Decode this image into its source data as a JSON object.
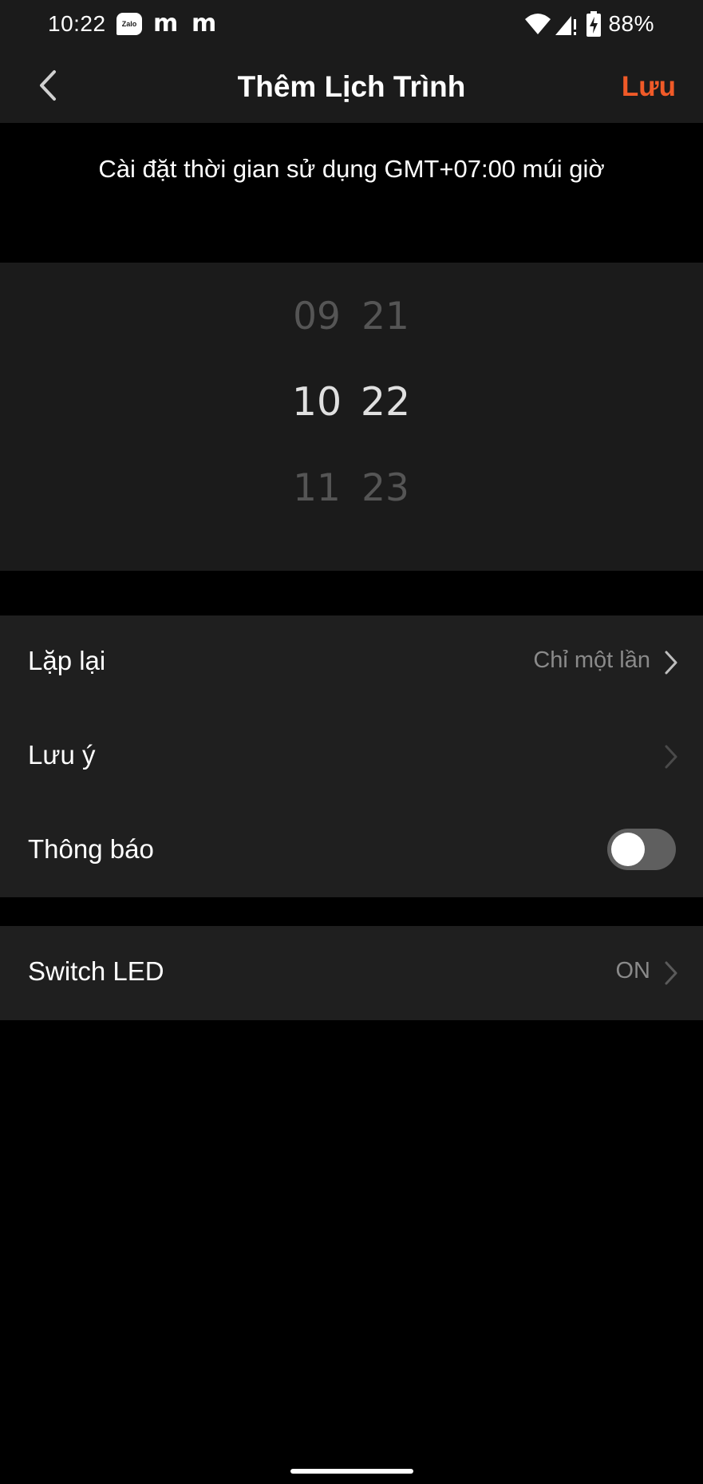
{
  "status_bar": {
    "time": "10:22",
    "zalo_label": "Zalo",
    "m1": "m",
    "m2": "m",
    "battery": "88%",
    "icons": [
      "zalo-icon",
      "m-app-icon",
      "m-app-icon",
      "wifi-icon",
      "signal-icon",
      "battery-icon"
    ]
  },
  "header": {
    "title": "Thêm Lịch Trình",
    "save_label": "Lưu",
    "accent_color": "#f05a28"
  },
  "timezone_note": "Cài đặt thời gian sử dụng GMT+07:00 múi giờ",
  "picker": {
    "hours": [
      "09",
      "10",
      "11"
    ],
    "minutes": [
      "21",
      "22",
      "23"
    ],
    "selected_hour": "10",
    "selected_minute": "22"
  },
  "settings": {
    "repeat": {
      "label": "Lặp lại",
      "value": "Chỉ một lần"
    },
    "note": {
      "label": "Lưu ý",
      "value": ""
    },
    "notify": {
      "label": "Thông báo",
      "enabled": false
    },
    "switch_led": {
      "label": "Switch LED",
      "value": "ON"
    }
  }
}
